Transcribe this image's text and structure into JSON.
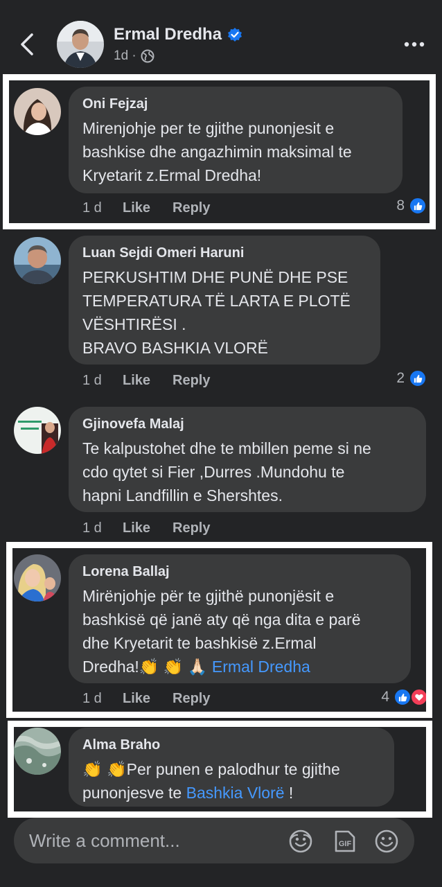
{
  "header": {
    "name": "Ermal Dredha",
    "meta": "1d ·"
  },
  "comments": [
    {
      "name": "Oni Fejzaj",
      "text": "Mirenjohje per te gjithe punonjesit e\nbashkise dhe angazhimin maksimal te\nKryetarit z.Ermal Dredha!",
      "time": "1 d",
      "like": "Like",
      "reply": "Reply",
      "reactions": "8"
    },
    {
      "name": "Luan Sejdi Omeri Haruni",
      "text": "PERKUSHTIM DHE PUNË DHE PSE\nTEMPERATURA TË LARTA E PLOTË\nVËSHTIRËSI .\nBRAVO BASHKIA VLORË",
      "time": "1 d",
      "like": "Like",
      "reply": "Reply",
      "reactions": "2"
    },
    {
      "name": "Gjinovefa Malaj",
      "text": "Te kalpustohet dhe te mbillen peme si ne\ncdo qytet si Fier ,Durres .Mundohu te\nhapni Landfillin e Shershtes.",
      "time": "1 d",
      "like": "Like",
      "reply": "Reply",
      "reactions": ""
    },
    {
      "name": "Lorena Ballaj",
      "text_before": "Mirënjohje për te gjithë punonjësit e\nbashkisë që janë aty që nga dita e parë\ndhe Kryetarit te bashkisë z.Ermal\nDredha!👏 👏 🙏🏻",
      "link": "Ermal Dredha",
      "time": "1 d",
      "like": "Like",
      "reply": "Reply",
      "reactions": "4"
    },
    {
      "name": "Alma Braho",
      "text_before": "👏 👏Per  punen e palodhur te gjithe\npunonjesve te ",
      "link": "Bashkia Vlorë",
      "text_after": " !"
    }
  ],
  "composer": {
    "placeholder": "Write a comment..."
  },
  "colors": {
    "background": "#232426",
    "bubble": "#3a3b3c",
    "link": "#4599ff",
    "like": "#1877f2",
    "love": "#f33e58"
  }
}
